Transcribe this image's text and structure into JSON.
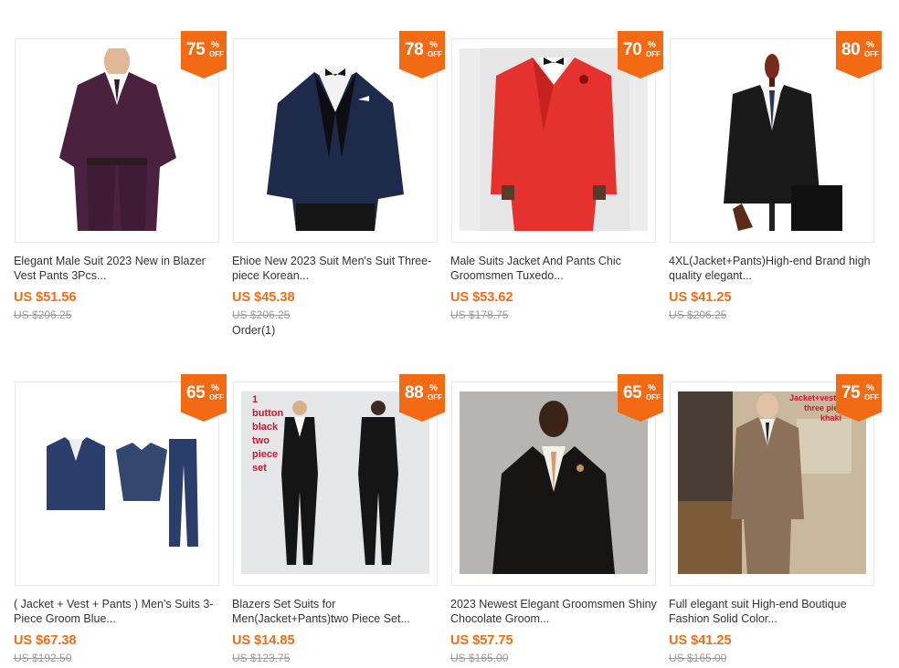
{
  "products": [
    {
      "discount": "75",
      "title": "Elegant Male Suit 2023 New in Blazer Vest Pants 3Pcs...",
      "price": "US $51.56",
      "original_price": "US $206.25",
      "orders": ""
    },
    {
      "discount": "78",
      "title": "Ehioe New 2023 Suit Men's Suit Three-piece Korean...",
      "price": "US $45.38",
      "original_price": "US $206.25",
      "orders": "Order(1)"
    },
    {
      "discount": "70",
      "title": "Male Suits Jacket And Pants Chic Groomsmen Tuxedo...",
      "price": "US $53.62",
      "original_price": "US $178.75",
      "orders": ""
    },
    {
      "discount": "80",
      "title": "4XL(Jacket+Pants)High-end Brand high quality elegant...",
      "price": "US $41.25",
      "original_price": "US $206.25",
      "orders": ""
    },
    {
      "discount": "65",
      "title": "( Jacket + Vest + Pants ) Men's Suits 3-Piece Groom Blue...",
      "price": "US $67.38",
      "original_price": "US $192.50",
      "orders": ""
    },
    {
      "discount": "88",
      "title": "Blazers Set Suits for Men(Jacket+Pants)two Piece Set...",
      "price": "US $14.85",
      "original_price": "US $123.75",
      "orders": "",
      "image_text": [
        "1",
        "button",
        "black",
        "two",
        "piece",
        "set"
      ]
    },
    {
      "discount": "65",
      "title": "2023 Newest Elegant Groomsmen Shiny Chocolate Groom...",
      "price": "US $57.75",
      "original_price": "US $165.00",
      "orders": ""
    },
    {
      "discount": "75",
      "title": "Full elegant suit High-end Boutique Fashion Solid Color...",
      "price": "US $41.25",
      "original_price": "US $165.00",
      "orders": "",
      "image_text": [
        "Jacket+vest+",
        "three pie",
        "khaki"
      ]
    }
  ],
  "badge": {
    "percent_symbol": "%",
    "off_label": "OFF"
  },
  "colors": {
    "accent": "#f36a15",
    "strike": "#999999",
    "text": "#333333"
  }
}
